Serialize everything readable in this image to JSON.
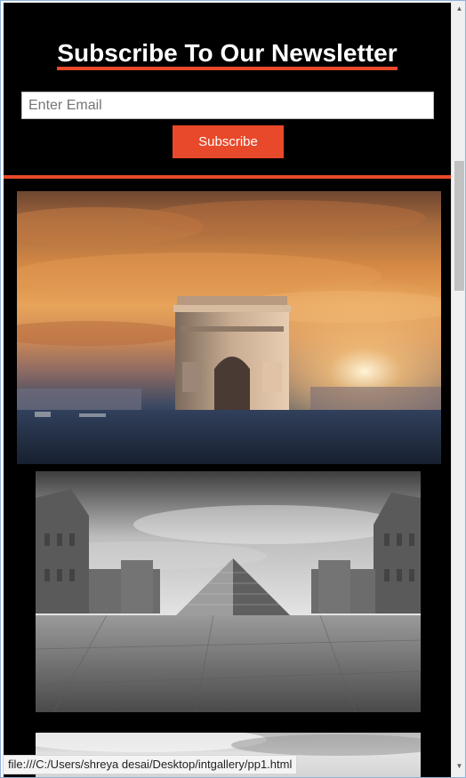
{
  "newsletter": {
    "title": "Subscribe To Our Newsletter",
    "email_placeholder": "Enter Email",
    "email_value": "",
    "subscribe_label": "Subscribe"
  },
  "gallery": {
    "images": [
      {
        "name": "arc-de-triomphe-photo"
      },
      {
        "name": "louvre-pyramid-photo"
      },
      {
        "name": "third-gallery-photo"
      }
    ]
  },
  "status_bar": {
    "url": "file:///C:/Users/shreya desai/Desktop/intgallery/pp1.html"
  },
  "colors": {
    "accent": "#e8492a",
    "background": "#000000",
    "heading_text": "#ffffff"
  },
  "icons": {
    "scroll_up": "scroll-up-arrow-icon",
    "scroll_down": "scroll-down-arrow-icon"
  }
}
